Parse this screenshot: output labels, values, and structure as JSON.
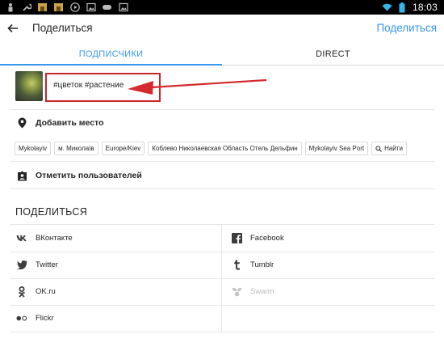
{
  "status_bar": {
    "time": "18:03",
    "left_icons": [
      "person-icon",
      "wrench-icon",
      "castle-icon",
      "castle-icon",
      "play-icon",
      "image-icon",
      "gamepad-icon",
      "image-icon"
    ],
    "right_icons": [
      "wifi-icon",
      "battery-icon"
    ]
  },
  "app_bar": {
    "title": "Поделиться",
    "action": "Поделиться"
  },
  "tabs": [
    {
      "label": "ПОДПИСЧИКИ",
      "active": true
    },
    {
      "label": "DIRECT",
      "active": false
    }
  ],
  "caption": {
    "value": "#цветок #растение"
  },
  "location": {
    "label": "Добавить место",
    "chips": [
      {
        "label": "Mykolayiv"
      },
      {
        "label": "м. Миколаїв"
      },
      {
        "label": "Europe/Kiev"
      },
      {
        "label": "Коблево Николаевская Область Отель Дельфин"
      },
      {
        "label": "Mykolayiv Sea Port"
      },
      {
        "label": "Найти",
        "icon": "search-icon"
      }
    ]
  },
  "tag_people": {
    "label": "Отметить пользователей"
  },
  "share": {
    "header": "ПОДЕЛИТЬСЯ",
    "left": [
      {
        "label": "ВКонтакте",
        "icon": "vk-icon"
      },
      {
        "label": "Twitter",
        "icon": "twitter-icon"
      },
      {
        "label": "OK.ru",
        "icon": "odnoklassniki-icon"
      },
      {
        "label": "Flickr",
        "icon": "flickr-icon"
      }
    ],
    "right": [
      {
        "label": "Facebook",
        "icon": "facebook-icon"
      },
      {
        "label": "Tumblr",
        "icon": "tumblr-icon"
      },
      {
        "label": "Swarm",
        "icon": "swarm-icon",
        "disabled": true
      }
    ]
  },
  "colors": {
    "accent": "#3897f0",
    "highlight": "#c9242a",
    "text": "#262626"
  }
}
